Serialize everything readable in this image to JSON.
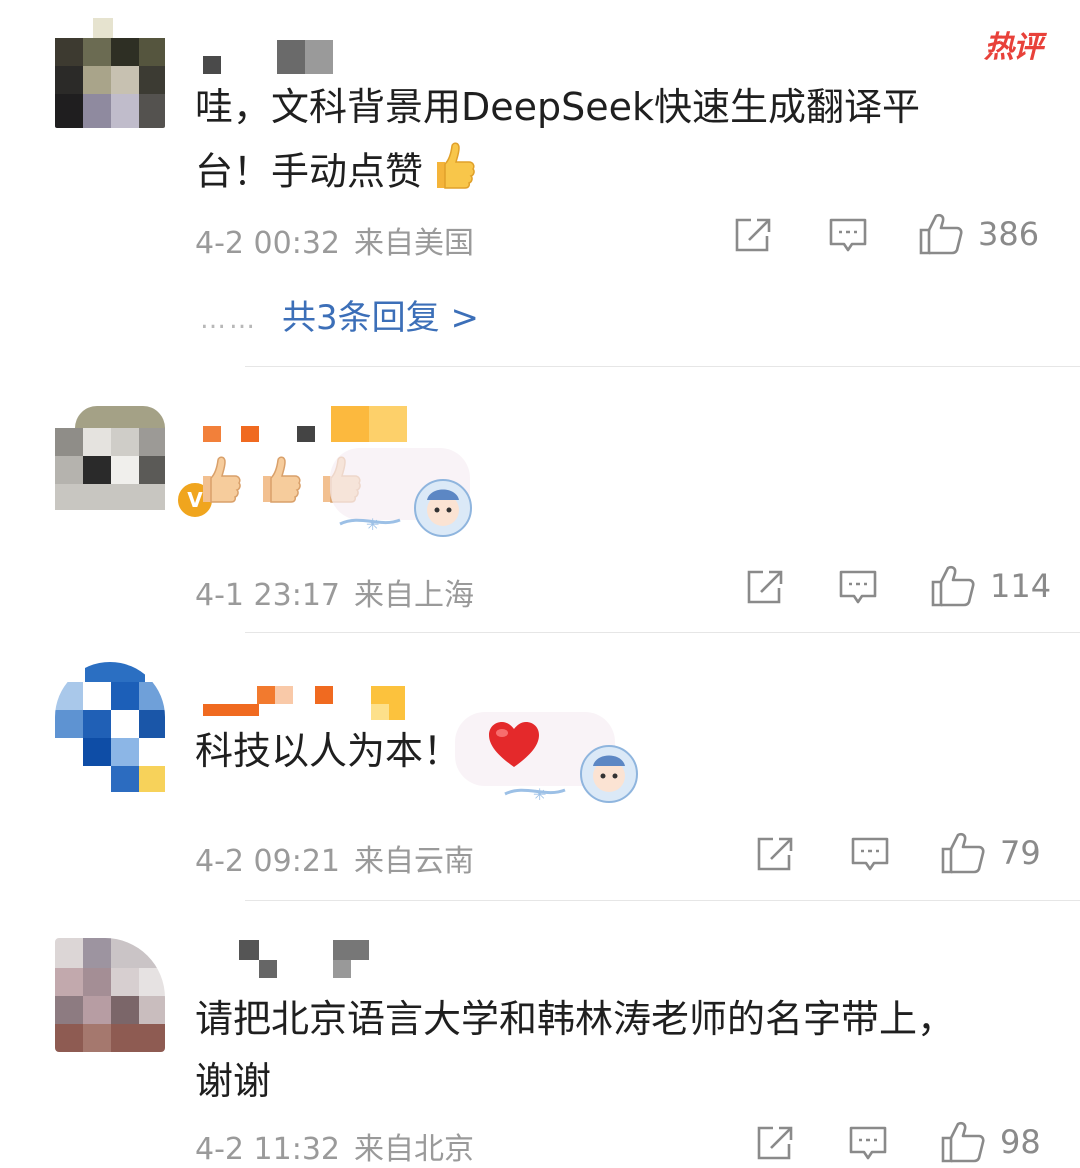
{
  "hot_badge": "热评",
  "comments": [
    {
      "text_line1": "哇，文科背景用DeepSeek快速生成翻译平",
      "text_line2": "台！手动点赞",
      "time": "4-2 00:32",
      "location": "来自美国",
      "likes": "386",
      "replies_label": "共3条回复 >",
      "replies_dots": "……"
    },
    {
      "text": "",
      "time": "4-1 23:17",
      "location": "来自上海",
      "likes": "114"
    },
    {
      "text": "科技以人为本！",
      "time": "4-2 09:21",
      "location": "来自云南",
      "likes": "79"
    },
    {
      "text_line1": "请把北京语言大学和韩林涛老师的名字带上，",
      "text_line2": "谢谢",
      "time": "4-2 11:32",
      "location": "来自北京",
      "likes": "98"
    }
  ],
  "icons": {
    "share": "share-icon",
    "comment": "comment-icon",
    "like": "thumbs-up-icon",
    "vip": "v-badge-icon"
  },
  "colors": {
    "link": "#3c6fb8",
    "hot": "#e8413a",
    "meta": "#9a9a9a"
  }
}
